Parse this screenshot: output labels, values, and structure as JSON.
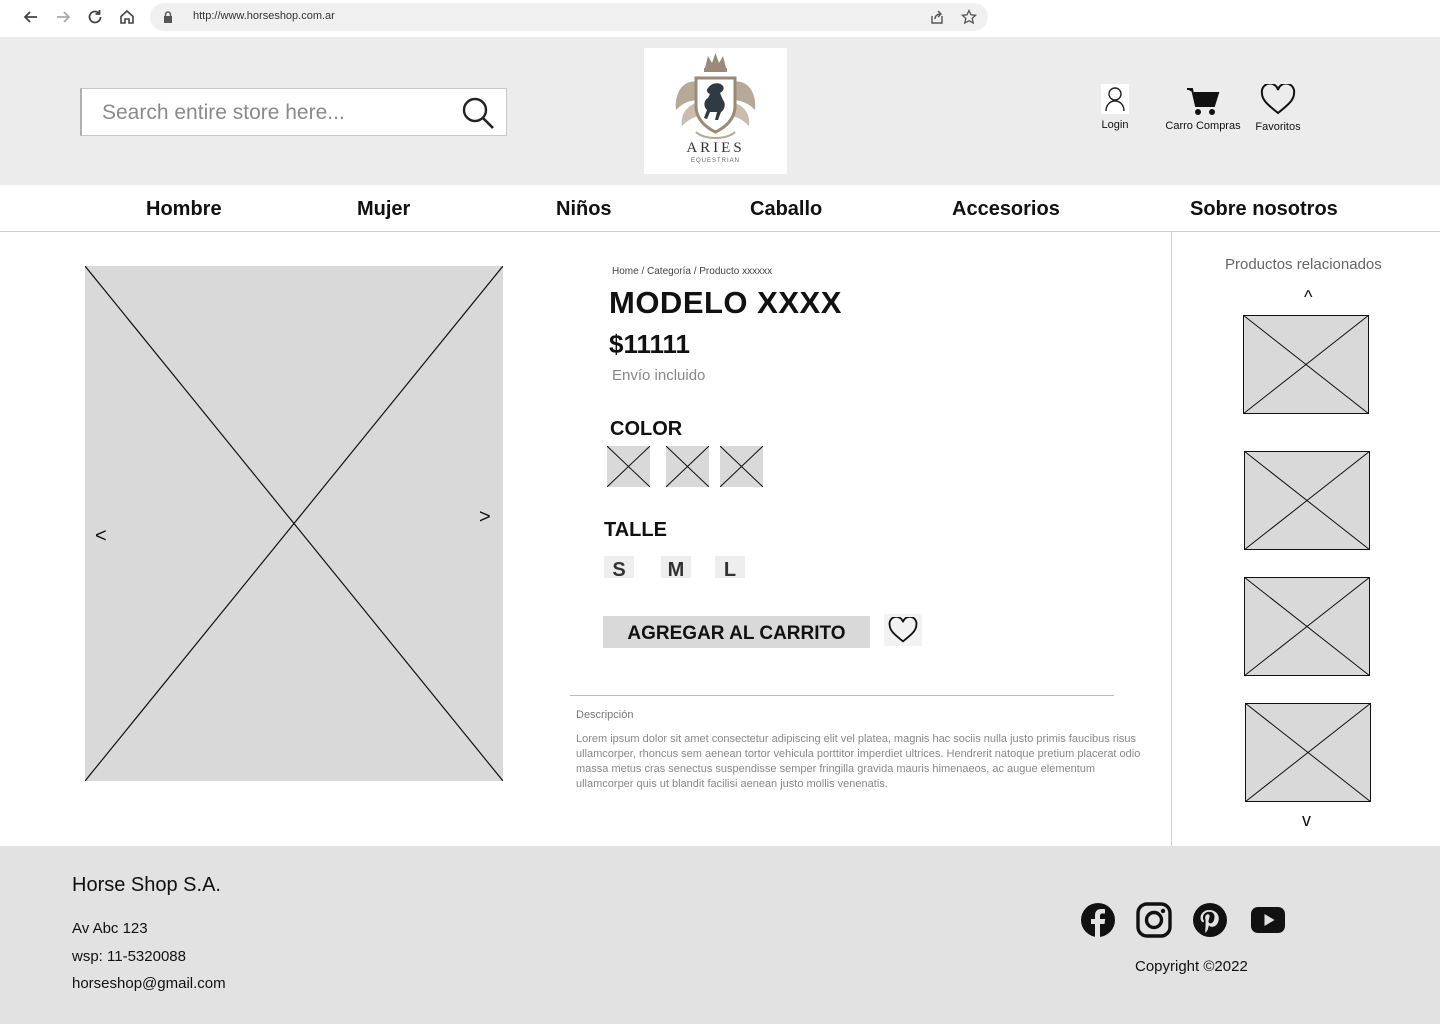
{
  "browser": {
    "url": "http://www.horseshop.com.ar"
  },
  "header": {
    "search_placeholder": "Search entire store here...",
    "logo_text": "ARIES",
    "logo_subtext": "EQUESTRIAN",
    "actions": {
      "login": "Login",
      "cart": "Carro Compras",
      "favorites": "Favoritos"
    }
  },
  "nav": {
    "items": [
      "Hombre",
      "Mujer",
      "Niños",
      "Caballo",
      "Accesorios",
      "Sobre nosotros"
    ]
  },
  "gallery": {
    "prev": "<",
    "next": ">"
  },
  "product": {
    "breadcrumb": "Home / Categoría / Producto xxxxxx",
    "title": "MODELO XXXX",
    "price": "$11111",
    "shipping": "Envío incluido",
    "color_label": "COLOR",
    "size_label": "TALLE",
    "sizes": [
      "S",
      "M",
      "L"
    ],
    "add_to_cart": "AGREGAR AL CARRITO",
    "description_label": "Descripción",
    "description": "Lorem ipsum dolor sit amet consectetur adipiscing elit vel platea, magnis hac sociis nulla justo primis faucibus risus ullamcorper, rhoncus sem aenean tortor vehicula porttitor imperdiet ultrices. Hendrerit natoque pretium placerat odio massa metus cras senectus suspendisse semper fringilla gravida mauris himenaeos, ac augue elementum ullamcorper quis ut blandit facilisi aenean justo mollis venenatis."
  },
  "related": {
    "title": "Productos relacionados",
    "up": "^",
    "down": "v"
  },
  "footer": {
    "company": "Horse Shop S.A.",
    "address": "Av Abc 123",
    "phone": "wsp: 11-5320088",
    "email": "horseshop@gmail.com",
    "copyright": "Copyright ©2022",
    "social_icons": [
      "facebook-icon",
      "instagram-icon",
      "pinterest-icon",
      "youtube-icon"
    ]
  }
}
